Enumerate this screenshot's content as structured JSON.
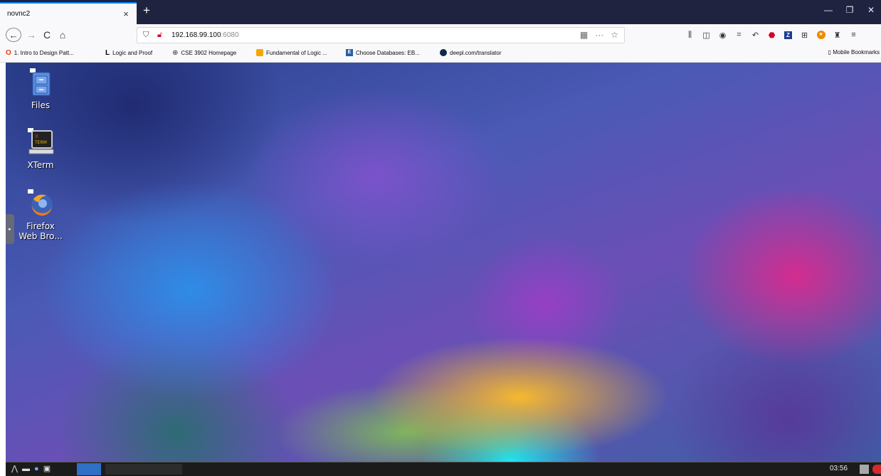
{
  "browser": {
    "tab": {
      "title": "novnc2",
      "close_glyph": "×"
    },
    "new_tab_glyph": "+",
    "window_controls": {
      "minimize": "—",
      "restore": "❐",
      "close": "✕"
    },
    "nav": {
      "back": "←",
      "forward": "→",
      "reload": "C",
      "home": "⌂"
    },
    "url": {
      "host": "192.168.99.100",
      "port": ":6080"
    },
    "url_actions": {
      "qr": "▦",
      "more": "···",
      "bookmark": "☆"
    },
    "toolbar_icons": [
      "library-icon",
      "sidebar-icon",
      "account-icon",
      "screenshot-icon",
      "undo-icon",
      "adblock-icon",
      "zotero-icon",
      "grid-icon",
      "extension-icon",
      "dev-icon",
      "menu-icon"
    ],
    "bookmarks": [
      {
        "label": "1. Intro to Design Patt...",
        "icon": "o"
      },
      {
        "label": "Logic and Proof",
        "icon": "L"
      },
      {
        "label": "CSE 3902 Homepage",
        "icon": "globe"
      },
      {
        "label": "Fundamental of Logic ...",
        "icon": "fund"
      },
      {
        "label": "Choose Databases: EB...",
        "icon": "eb"
      },
      {
        "label": "deepl.com/translator",
        "icon": "deepl"
      }
    ],
    "mobile_bookmarks": "Mobile Bookmarks"
  },
  "desktop": {
    "icons": [
      {
        "label": "Files"
      },
      {
        "label": "XTerm"
      },
      {
        "label_line1": "Firefox",
        "label_line2": "Web Bro..."
      }
    ],
    "side_handle_glyph": "▸"
  },
  "taskbar": {
    "clock": "03:56"
  }
}
